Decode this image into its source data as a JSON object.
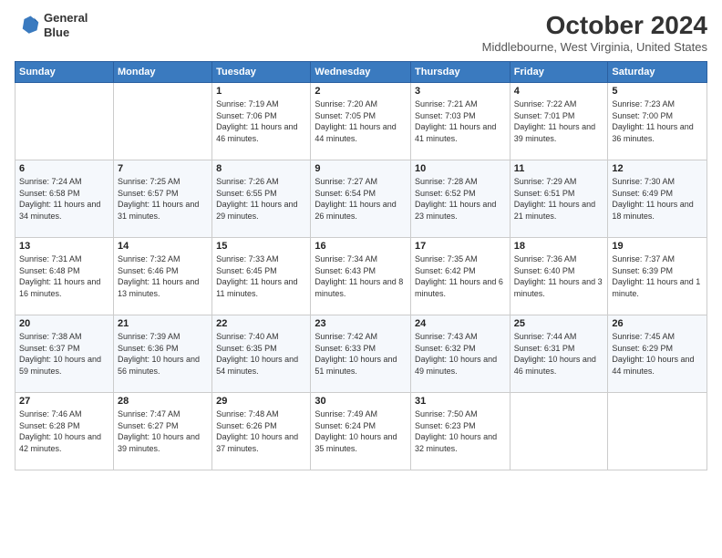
{
  "header": {
    "logo_line1": "General",
    "logo_line2": "Blue",
    "title": "October 2024",
    "location": "Middlebourne, West Virginia, United States"
  },
  "weekdays": [
    "Sunday",
    "Monday",
    "Tuesday",
    "Wednesday",
    "Thursday",
    "Friday",
    "Saturday"
  ],
  "weeks": [
    [
      {
        "day": "",
        "sunrise": "",
        "sunset": "",
        "daylight": ""
      },
      {
        "day": "",
        "sunrise": "",
        "sunset": "",
        "daylight": ""
      },
      {
        "day": "1",
        "sunrise": "Sunrise: 7:19 AM",
        "sunset": "Sunset: 7:06 PM",
        "daylight": "Daylight: 11 hours and 46 minutes."
      },
      {
        "day": "2",
        "sunrise": "Sunrise: 7:20 AM",
        "sunset": "Sunset: 7:05 PM",
        "daylight": "Daylight: 11 hours and 44 minutes."
      },
      {
        "day": "3",
        "sunrise": "Sunrise: 7:21 AM",
        "sunset": "Sunset: 7:03 PM",
        "daylight": "Daylight: 11 hours and 41 minutes."
      },
      {
        "day": "4",
        "sunrise": "Sunrise: 7:22 AM",
        "sunset": "Sunset: 7:01 PM",
        "daylight": "Daylight: 11 hours and 39 minutes."
      },
      {
        "day": "5",
        "sunrise": "Sunrise: 7:23 AM",
        "sunset": "Sunset: 7:00 PM",
        "daylight": "Daylight: 11 hours and 36 minutes."
      }
    ],
    [
      {
        "day": "6",
        "sunrise": "Sunrise: 7:24 AM",
        "sunset": "Sunset: 6:58 PM",
        "daylight": "Daylight: 11 hours and 34 minutes."
      },
      {
        "day": "7",
        "sunrise": "Sunrise: 7:25 AM",
        "sunset": "Sunset: 6:57 PM",
        "daylight": "Daylight: 11 hours and 31 minutes."
      },
      {
        "day": "8",
        "sunrise": "Sunrise: 7:26 AM",
        "sunset": "Sunset: 6:55 PM",
        "daylight": "Daylight: 11 hours and 29 minutes."
      },
      {
        "day": "9",
        "sunrise": "Sunrise: 7:27 AM",
        "sunset": "Sunset: 6:54 PM",
        "daylight": "Daylight: 11 hours and 26 minutes."
      },
      {
        "day": "10",
        "sunrise": "Sunrise: 7:28 AM",
        "sunset": "Sunset: 6:52 PM",
        "daylight": "Daylight: 11 hours and 23 minutes."
      },
      {
        "day": "11",
        "sunrise": "Sunrise: 7:29 AM",
        "sunset": "Sunset: 6:51 PM",
        "daylight": "Daylight: 11 hours and 21 minutes."
      },
      {
        "day": "12",
        "sunrise": "Sunrise: 7:30 AM",
        "sunset": "Sunset: 6:49 PM",
        "daylight": "Daylight: 11 hours and 18 minutes."
      }
    ],
    [
      {
        "day": "13",
        "sunrise": "Sunrise: 7:31 AM",
        "sunset": "Sunset: 6:48 PM",
        "daylight": "Daylight: 11 hours and 16 minutes."
      },
      {
        "day": "14",
        "sunrise": "Sunrise: 7:32 AM",
        "sunset": "Sunset: 6:46 PM",
        "daylight": "Daylight: 11 hours and 13 minutes."
      },
      {
        "day": "15",
        "sunrise": "Sunrise: 7:33 AM",
        "sunset": "Sunset: 6:45 PM",
        "daylight": "Daylight: 11 hours and 11 minutes."
      },
      {
        "day": "16",
        "sunrise": "Sunrise: 7:34 AM",
        "sunset": "Sunset: 6:43 PM",
        "daylight": "Daylight: 11 hours and 8 minutes."
      },
      {
        "day": "17",
        "sunrise": "Sunrise: 7:35 AM",
        "sunset": "Sunset: 6:42 PM",
        "daylight": "Daylight: 11 hours and 6 minutes."
      },
      {
        "day": "18",
        "sunrise": "Sunrise: 7:36 AM",
        "sunset": "Sunset: 6:40 PM",
        "daylight": "Daylight: 11 hours and 3 minutes."
      },
      {
        "day": "19",
        "sunrise": "Sunrise: 7:37 AM",
        "sunset": "Sunset: 6:39 PM",
        "daylight": "Daylight: 11 hours and 1 minute."
      }
    ],
    [
      {
        "day": "20",
        "sunrise": "Sunrise: 7:38 AM",
        "sunset": "Sunset: 6:37 PM",
        "daylight": "Daylight: 10 hours and 59 minutes."
      },
      {
        "day": "21",
        "sunrise": "Sunrise: 7:39 AM",
        "sunset": "Sunset: 6:36 PM",
        "daylight": "Daylight: 10 hours and 56 minutes."
      },
      {
        "day": "22",
        "sunrise": "Sunrise: 7:40 AM",
        "sunset": "Sunset: 6:35 PM",
        "daylight": "Daylight: 10 hours and 54 minutes."
      },
      {
        "day": "23",
        "sunrise": "Sunrise: 7:42 AM",
        "sunset": "Sunset: 6:33 PM",
        "daylight": "Daylight: 10 hours and 51 minutes."
      },
      {
        "day": "24",
        "sunrise": "Sunrise: 7:43 AM",
        "sunset": "Sunset: 6:32 PM",
        "daylight": "Daylight: 10 hours and 49 minutes."
      },
      {
        "day": "25",
        "sunrise": "Sunrise: 7:44 AM",
        "sunset": "Sunset: 6:31 PM",
        "daylight": "Daylight: 10 hours and 46 minutes."
      },
      {
        "day": "26",
        "sunrise": "Sunrise: 7:45 AM",
        "sunset": "Sunset: 6:29 PM",
        "daylight": "Daylight: 10 hours and 44 minutes."
      }
    ],
    [
      {
        "day": "27",
        "sunrise": "Sunrise: 7:46 AM",
        "sunset": "Sunset: 6:28 PM",
        "daylight": "Daylight: 10 hours and 42 minutes."
      },
      {
        "day": "28",
        "sunrise": "Sunrise: 7:47 AM",
        "sunset": "Sunset: 6:27 PM",
        "daylight": "Daylight: 10 hours and 39 minutes."
      },
      {
        "day": "29",
        "sunrise": "Sunrise: 7:48 AM",
        "sunset": "Sunset: 6:26 PM",
        "daylight": "Daylight: 10 hours and 37 minutes."
      },
      {
        "day": "30",
        "sunrise": "Sunrise: 7:49 AM",
        "sunset": "Sunset: 6:24 PM",
        "daylight": "Daylight: 10 hours and 35 minutes."
      },
      {
        "day": "31",
        "sunrise": "Sunrise: 7:50 AM",
        "sunset": "Sunset: 6:23 PM",
        "daylight": "Daylight: 10 hours and 32 minutes."
      },
      {
        "day": "",
        "sunrise": "",
        "sunset": "",
        "daylight": ""
      },
      {
        "day": "",
        "sunrise": "",
        "sunset": "",
        "daylight": ""
      }
    ]
  ]
}
